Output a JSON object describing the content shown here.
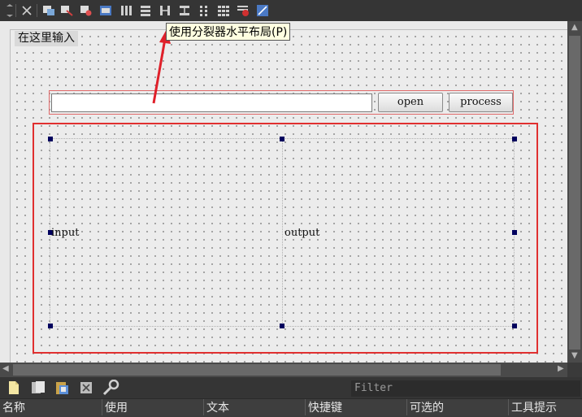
{
  "toolbar": {
    "icons": [
      "toolbar-grip-icon",
      "close-icon",
      "edit-widgets-icon",
      "edit-signals-slots-icon",
      "edit-buddies-icon",
      "edit-tab-order-icon",
      "layout-horizontal-icon",
      "layout-vertical-icon",
      "layout-horizontal-splitter-icon",
      "layout-vertical-splitter-icon",
      "layout-form-icon",
      "layout-grid-icon",
      "break-layout-icon",
      "adjust-size-icon"
    ]
  },
  "tooltip": {
    "text": "使用分裂器水平布局(P)"
  },
  "form": {
    "menu_placeholder": "在这里输入",
    "path_input_value": "",
    "open_label": "open",
    "process_label": "process",
    "input_label": "input",
    "output_label": "output"
  },
  "action_editor": {
    "filter_placeholder": "Filter",
    "columns": [
      "名称",
      "使用",
      "文本",
      "快捷键",
      "可选的",
      "工具提示"
    ]
  },
  "colors": {
    "highlight": "#e03030",
    "handle": "#00005e",
    "tooltip_bg": "#ffffe1"
  }
}
